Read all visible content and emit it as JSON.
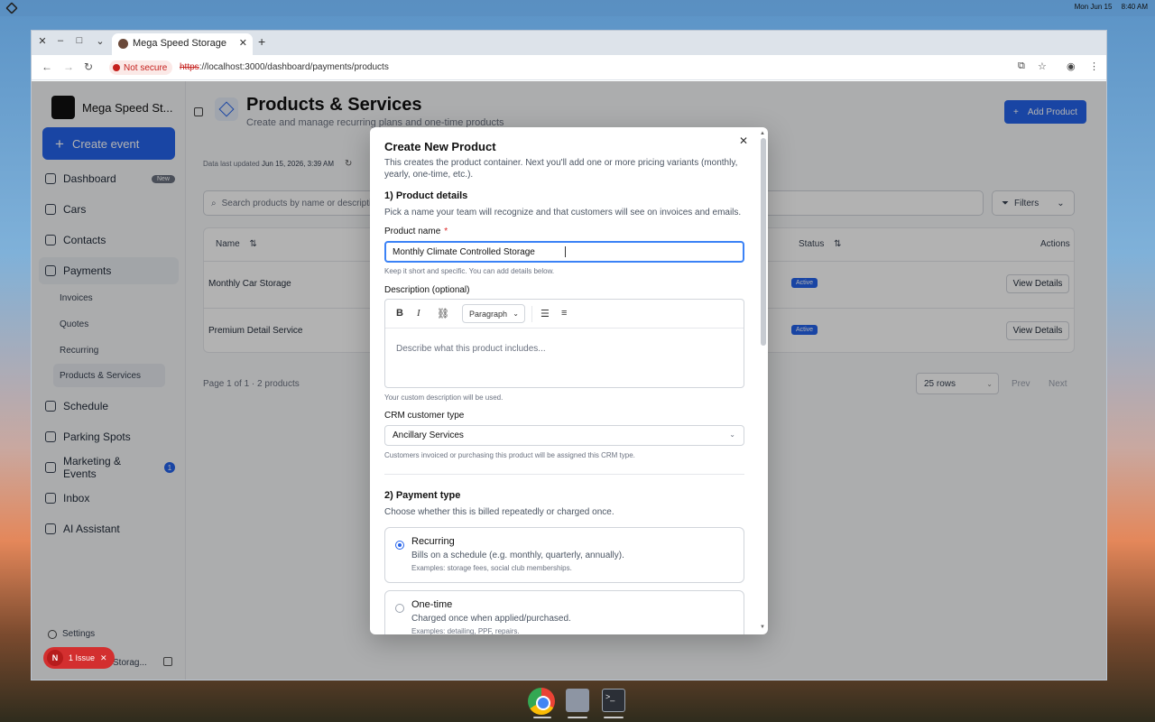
{
  "os": {
    "date": "Mon Jun 15",
    "time": "8:40 AM"
  },
  "browser": {
    "tab_title": "Mega Speed Storage",
    "not_secure": "Not secure",
    "url_scheme": "https",
    "url_rest": "://localhost:3000/dashboard/payments/products"
  },
  "sidebar": {
    "brand": "Mega Speed St...",
    "create_event": "Create event",
    "items": [
      {
        "label": "Dashboard",
        "badge": "New"
      },
      {
        "label": "Cars"
      },
      {
        "label": "Contacts"
      },
      {
        "label": "Payments"
      },
      {
        "label": "Schedule"
      },
      {
        "label": "Parking Spots"
      },
      {
        "label": "Marketing & Events",
        "count": "1"
      },
      {
        "label": "Inbox"
      },
      {
        "label": "AI Assistant"
      }
    ],
    "sub_items": [
      "Invoices",
      "Quotes",
      "Recurring",
      "Products & Services"
    ],
    "settings": "Settings",
    "footer": "Storag...",
    "issue": {
      "letter": "N",
      "label": "1 Issue"
    }
  },
  "page": {
    "title": "Products & Services",
    "subtitle": "Create and manage recurring plans and one-time products",
    "add_button": "Add Product",
    "updated_prefix": "Data last updated",
    "updated_value": "Jun 15, 2026, 3:39 AM",
    "search_placeholder": "Search products by name or descripti",
    "filters": "Filters",
    "columns": {
      "name": "Name",
      "status": "Status",
      "actions": "Actions"
    },
    "rows": [
      {
        "name": "Monthly Car Storage",
        "status": "Active",
        "action": "View Details"
      },
      {
        "name": "Premium Detail Service",
        "status": "Active",
        "action": "View Details"
      }
    ],
    "pager": "Page 1 of 1 · 2 products",
    "rows_per_page": "25 rows",
    "prev": "Prev",
    "next": "Next"
  },
  "modal": {
    "title": "Create New Product",
    "description": "This creates the product container. Next you'll add one or more pricing variants (monthly, yearly, one-time, etc.).",
    "section1_title": "1) Product details",
    "section1_desc": "Pick a name your team will recognize and that customers will see on invoices and emails.",
    "name_label": "Product name",
    "name_required": "*",
    "name_value": "Monthly Climate Controlled Storage",
    "name_hint": "Keep it short and specific. You can add details below.",
    "desc_label": "Description (optional)",
    "paragraph": "Paragraph",
    "desc_placeholder": "Describe what this product includes...",
    "desc_hint": "Your custom description will be used.",
    "crm_label": "CRM customer type",
    "crm_value": "Ancillary Services",
    "crm_hint": "Customers invoiced or purchasing this product will be assigned this CRM type.",
    "section2_title": "2) Payment type",
    "section2_desc": "Choose whether this is billed repeatedly or charged once.",
    "options": [
      {
        "title": "Recurring",
        "line": "Bills on a schedule (e.g. monthly, quarterly, annually).",
        "examples": "Examples: storage fees, social club memberships.",
        "selected": true
      },
      {
        "title": "One-time",
        "line": "Charged once when applied/purchased.",
        "examples": "Examples: detailing, PPF, repairs.",
        "selected": false
      }
    ]
  },
  "colors": {
    "accent": "#2563eb",
    "danger": "#d32f2f"
  }
}
